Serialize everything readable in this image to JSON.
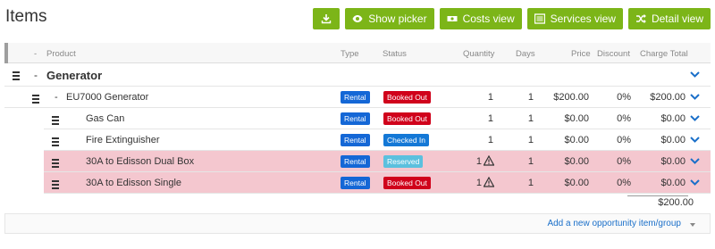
{
  "page_title": "Items",
  "toolbar": {
    "download_icon": "download-icon",
    "show_picker": "Show picker",
    "costs_view": "Costs view",
    "services_view": "Services view",
    "detail_view": "Detail view"
  },
  "columns": {
    "collapse": "-",
    "product": "Product",
    "type": "Type",
    "status": "Status",
    "quantity": "Quantity",
    "days": "Days",
    "price": "Price",
    "discount": "Discount",
    "charge_total": "Charge Total"
  },
  "group": {
    "toggle": "-",
    "name": "Generator"
  },
  "parent_item": {
    "toggle": "-",
    "name": "EU7000 Generator",
    "type": "Rental",
    "status": "Booked Out",
    "quantity": "1",
    "days": "1",
    "price": "$200.00",
    "discount": "0%",
    "charge_total": "$200.00"
  },
  "children": [
    {
      "name": "Gas Can",
      "type": "Rental",
      "status": "Booked Out",
      "quantity": "1",
      "days": "1",
      "price": "$0.00",
      "discount": "0%",
      "charge_total": "$0.00"
    },
    {
      "name": "Fire Extinguisher",
      "type": "Rental",
      "status": "Checked In",
      "quantity": "1",
      "days": "1",
      "price": "$0.00",
      "discount": "0%",
      "charge_total": "$0.00"
    },
    {
      "name": "30A to Edisson Dual Box",
      "type": "Rental",
      "status": "Reserved",
      "quantity": "1",
      "days": "1",
      "price": "$0.00",
      "discount": "0%",
      "charge_total": "$0.00"
    },
    {
      "name": "30A to Edisson Single",
      "type": "Rental",
      "status": "Booked Out",
      "quantity": "1",
      "days": "1",
      "price": "$0.00",
      "discount": "0%",
      "charge_total": "$0.00"
    }
  ],
  "grand_total": "$200.00",
  "footer": {
    "add_link": "Add a new opportunity item/group"
  },
  "colors": {
    "button_green": "#7cb518",
    "rental_blue": "#1467d6",
    "booked_out_red": "#d0021b",
    "checked_in_blue": "#1478d6",
    "reserved_cyan": "#5bc0de",
    "shortage_row_pink": "#f4c7cf"
  }
}
